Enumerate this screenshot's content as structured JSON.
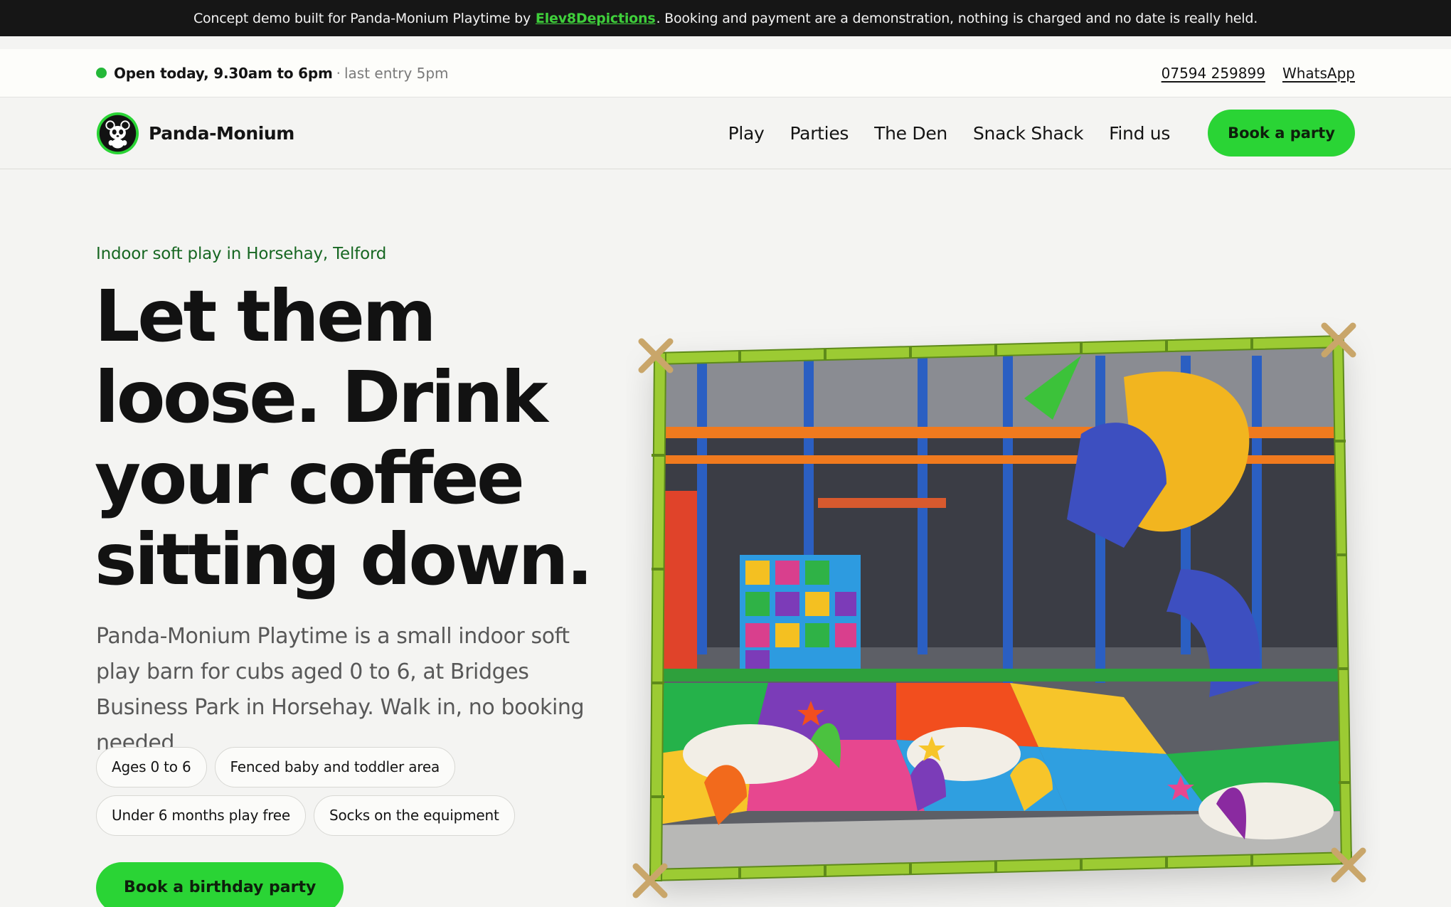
{
  "demo_banner": {
    "text_before": "Concept demo built for Panda-Monium Playtime by",
    "link": "Elev8Depictions",
    "text_after": ". Booking and payment are a demonstration, nothing is charged and no date is really held."
  },
  "info_bar": {
    "hours": "Open today, 9.30am to 6pm",
    "separator": "·",
    "last_entry": "last entry 5pm",
    "phone": "07594 259899",
    "whatsapp": "WhatsApp"
  },
  "header": {
    "brand": "Panda-Monium",
    "nav": [
      "Play",
      "Parties",
      "The Den",
      "Snack Shack",
      "Find us"
    ],
    "cta": "Book a party"
  },
  "hero": {
    "eyebrow": "Indoor soft play in Horsehay, Telford",
    "headline": [
      "Let them",
      "loose. Drink",
      "your coffee",
      "sitting down."
    ],
    "intro": "Panda-Monium Playtime is a small indoor soft play barn for cubs aged 0 to 6, at Bridges Business Park in Horsehay. Walk in, no booking needed.",
    "chips": [
      "Ages 0 to 6",
      "Fenced baby and toddler area",
      "Under 6 months play free",
      "Socks on the equipment"
    ],
    "cta": "Book a birthday party"
  },
  "colors": {
    "accent": "#2ad435",
    "banner_bg": "#161616",
    "eyebrow": "#176722",
    "bamboo": "#8cbe2a"
  },
  "icons": {
    "status": "green-dot",
    "logo": "panda-logo-icon"
  }
}
